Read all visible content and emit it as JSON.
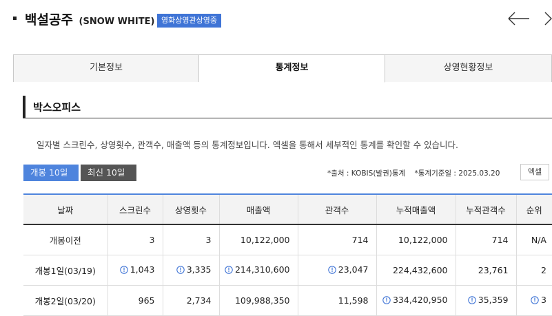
{
  "header": {
    "title": "백설공주",
    "title_en": "(SNOW WHITE)",
    "badge": "영화상영관상영중",
    "badge_color": "#3f74d6",
    "prev_icon": "arrow-left-icon",
    "next_icon": "chevron-right-icon"
  },
  "tabs": [
    {
      "label": "기본정보",
      "active": false
    },
    {
      "label": "통계정보",
      "active": true
    },
    {
      "label": "상영현황정보",
      "active": false
    }
  ],
  "section": {
    "title": "박스오피스"
  },
  "description": "일자별 스크린수, 상영횟수, 관객수, 매출액 등의 통계정보입니다. 엑셀을 통해서 세부적인 통계를 확인할 수 있습니다.",
  "filters": {
    "open_10": "개봉 10일",
    "latest_10": "최신 10일",
    "active": "open_10",
    "accent": "#4e84dd"
  },
  "source": {
    "provider": "*출처 : KOBIS(발권)통계",
    "base_date": "*통계기준일 : 2025.03.20"
  },
  "excel_button": "엑셀",
  "table": {
    "headers": [
      "날짜",
      "스크린수",
      "상영횟수",
      "매출액",
      "관객수",
      "누적매출액",
      "누적관객수",
      "순위"
    ],
    "rows": [
      {
        "date": "개봉이전",
        "screens": "3",
        "shows": "3",
        "revenue": "10,122,000",
        "audience": "714",
        "cum_revenue": "10,122,000",
        "cum_audience": "714",
        "rank": "N/A"
      },
      {
        "date": "개봉1일(03/19)",
        "screens": "1,043",
        "shows": "3,335",
        "revenue": "214,310,600",
        "audience": "23,047",
        "cum_revenue": "224,432,600",
        "cum_audience": "23,761",
        "rank": "2"
      },
      {
        "date": "개봉2일(03/20)",
        "screens": "965",
        "shows": "2,734",
        "revenue": "109,988,350",
        "audience": "11,598",
        "cum_revenue": "334,420,950",
        "cum_audience": "35,359",
        "rank": "3"
      }
    ],
    "info_icon": "info-circle-icon",
    "icon_color": "#3f74d6"
  }
}
